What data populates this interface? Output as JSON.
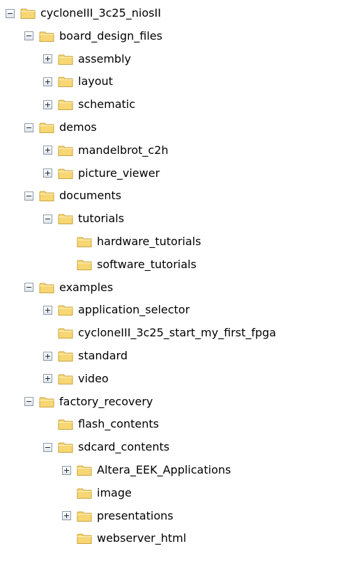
{
  "tree": {
    "nodes": [
      {
        "label": "cycloneIII_3c25_niosII",
        "depth": 0,
        "toggle": "collapse"
      },
      {
        "label": "board_design_files",
        "depth": 1,
        "toggle": "collapse"
      },
      {
        "label": "assembly",
        "depth": 2,
        "toggle": "expand"
      },
      {
        "label": "layout",
        "depth": 2,
        "toggle": "expand"
      },
      {
        "label": "schematic",
        "depth": 2,
        "toggle": "expand"
      },
      {
        "label": "demos",
        "depth": 1,
        "toggle": "collapse"
      },
      {
        "label": "mandelbrot_c2h",
        "depth": 2,
        "toggle": "expand"
      },
      {
        "label": "picture_viewer",
        "depth": 2,
        "toggle": "expand"
      },
      {
        "label": "documents",
        "depth": 1,
        "toggle": "collapse"
      },
      {
        "label": "tutorials",
        "depth": 2,
        "toggle": "collapse"
      },
      {
        "label": "hardware_tutorials",
        "depth": 3,
        "toggle": "none"
      },
      {
        "label": "software_tutorials",
        "depth": 3,
        "toggle": "none"
      },
      {
        "label": "examples",
        "depth": 1,
        "toggle": "collapse"
      },
      {
        "label": "application_selector",
        "depth": 2,
        "toggle": "expand"
      },
      {
        "label": "cycloneIII_3c25_start_my_first_fpga",
        "depth": 2,
        "toggle": "none"
      },
      {
        "label": "standard",
        "depth": 2,
        "toggle": "expand"
      },
      {
        "label": "video",
        "depth": 2,
        "toggle": "expand"
      },
      {
        "label": "factory_recovery",
        "depth": 1,
        "toggle": "collapse"
      },
      {
        "label": "flash_contents",
        "depth": 2,
        "toggle": "none"
      },
      {
        "label": "sdcard_contents",
        "depth": 2,
        "toggle": "collapse"
      },
      {
        "label": "Altera_EEK_Applications",
        "depth": 3,
        "toggle": "expand"
      },
      {
        "label": "image",
        "depth": 3,
        "toggle": "none"
      },
      {
        "label": "presentations",
        "depth": 3,
        "toggle": "expand"
      },
      {
        "label": "webserver_html",
        "depth": 3,
        "toggle": "none"
      }
    ]
  },
  "icons": {
    "folder": "folder-icon",
    "expand": "plus-box-icon",
    "collapse": "minus-box-icon"
  },
  "colors": {
    "folder_fill": "#f7d774",
    "folder_edge": "#c9a23a",
    "toggle_border": "#8c9aa8"
  }
}
